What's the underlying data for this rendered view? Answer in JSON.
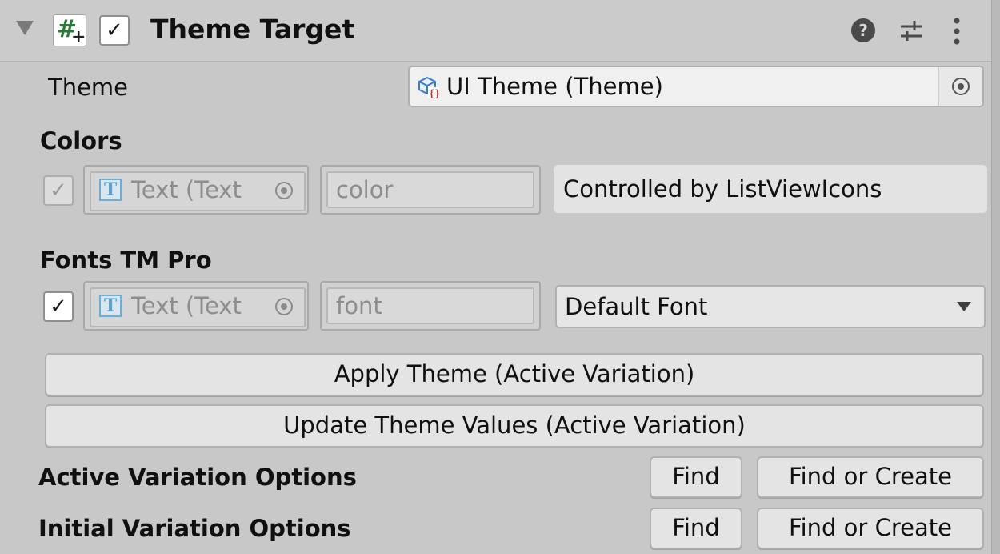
{
  "header": {
    "title": "Theme Target",
    "enabled_checked": true
  },
  "theme": {
    "label": "Theme",
    "value": "UI Theme (Theme)"
  },
  "colors": {
    "section_label": "Colors",
    "row": {
      "checked": true,
      "enabled": false,
      "object_text": "Text (Text",
      "property": "color",
      "status": "Controlled by ListViewIcons"
    }
  },
  "fonts": {
    "section_label": "Fonts TM Pro",
    "row": {
      "checked": true,
      "enabled": true,
      "object_text": "Text (Text",
      "property": "font",
      "selected_option": "Default Font"
    }
  },
  "buttons": {
    "apply": "Apply Theme (Active Variation)",
    "update": "Update Theme Values (Active Variation)"
  },
  "active_variation": {
    "label": "Active Variation Options",
    "find": "Find",
    "find_or_create": "Find or Create"
  },
  "initial_variation": {
    "label": "Initial Variation Options",
    "find": "Find",
    "find_or_create": "Find or Create"
  },
  "icons": {
    "foldout": "triangle-down-icon",
    "script": "script-icon",
    "help": "help-icon",
    "settings": "preset-settings-icon",
    "menu": "kebab-menu-icon",
    "theme_asset": "theme-asset-icon",
    "text_component": "text-component-icon",
    "object_picker": "object-picker-icon",
    "dropdown": "dropdown-arrow-icon"
  },
  "colors_palette": {
    "background": "#c8c8c8",
    "field": "#f0f0f0",
    "button": "#e4e4e4",
    "script_green": "#2b7a3a",
    "text_icon_blue": "#3a8fc8"
  }
}
